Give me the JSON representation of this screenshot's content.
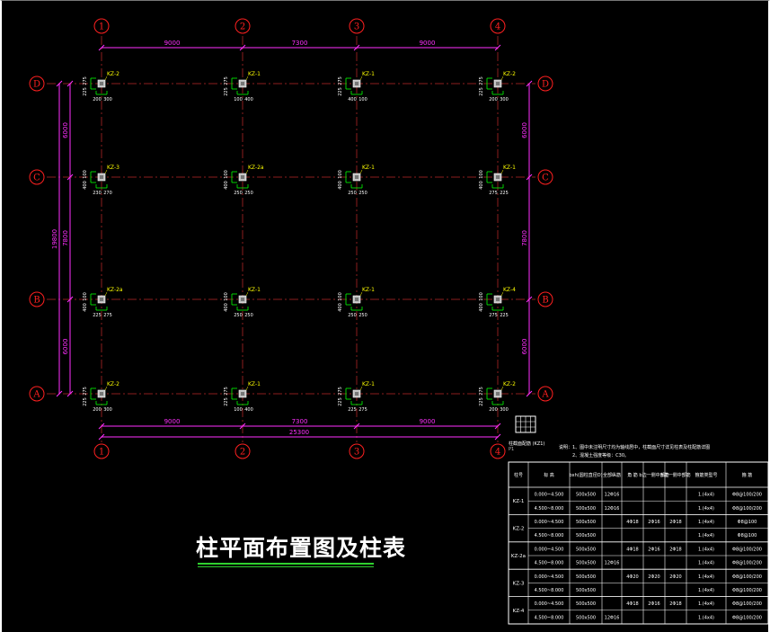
{
  "drawing": {
    "title": "柱平面布置图及柱表",
    "note_line1": "说明：1、图中未注明尺寸均为轴线居中，柱截面尺寸详见柱表及柱配筋详图",
    "note_line2": "2、混凝土强度等级：C30。",
    "section_label": "柱截面配筋  (KZ1)",
    "section_sub": "P1"
  },
  "axes": {
    "columns": [
      "1",
      "2",
      "3",
      "4"
    ],
    "rows": [
      "D",
      "C",
      "B",
      "A"
    ]
  },
  "dimensions": {
    "top_spans": [
      "9000",
      "7300",
      "9000"
    ],
    "bottom_spans": [
      "9000",
      "7300",
      "9000"
    ],
    "bottom_total": "25300",
    "left_spans": [
      "6000",
      "7800",
      "6000"
    ],
    "left_total": "19800",
    "right_spans": [
      "6000",
      "7800",
      "6000"
    ]
  },
  "columns": [
    {
      "label": "KZ-2",
      "dim_a": "275",
      "dim_b": "225",
      "bot_a": "200",
      "bot_b": "300"
    },
    {
      "label": "KZ-1",
      "dim_a": "275",
      "dim_b": "225",
      "bot_a": "100",
      "bot_b": "400"
    },
    {
      "label": "KZ-1",
      "dim_a": "275",
      "dim_b": "225",
      "bot_a": "400",
      "bot_b": "100"
    },
    {
      "label": "KZ-2",
      "dim_a": "275",
      "dim_b": "225",
      "bot_a": "200",
      "bot_b": "300"
    },
    {
      "label": "KZ-3",
      "dim_a": "100",
      "dim_b": "400",
      "bot_a": "230",
      "bot_b": "270"
    },
    {
      "label": "KZ-2a",
      "dim_a": "100",
      "dim_b": "400",
      "bot_a": "250",
      "bot_b": "250"
    },
    {
      "label": "KZ-1",
      "dim_a": "100",
      "dim_b": "400",
      "bot_a": "250",
      "bot_b": "250"
    },
    {
      "label": "KZ-1",
      "dim_a": "100",
      "dim_b": "400",
      "bot_a": "275",
      "bot_b": "225"
    },
    {
      "label": "KZ-2a",
      "dim_a": "100",
      "dim_b": "400",
      "bot_a": "225",
      "bot_b": "275"
    },
    {
      "label": "KZ-1",
      "dim_a": "100",
      "dim_b": "400",
      "bot_a": "250",
      "bot_b": "250"
    },
    {
      "label": "KZ-1",
      "dim_a": "100",
      "dim_b": "400",
      "bot_a": "250",
      "bot_b": "250"
    },
    {
      "label": "KZ-4",
      "dim_a": "100",
      "dim_b": "400",
      "bot_a": "275",
      "bot_b": "225"
    },
    {
      "label": "KZ-2",
      "dim_a": "275",
      "dim_b": "225",
      "bot_a": "200",
      "bot_b": "300"
    },
    {
      "label": "KZ-1",
      "dim_a": "275",
      "dim_b": "225",
      "bot_a": "100",
      "bot_b": "400"
    },
    {
      "label": "KZ-1",
      "dim_a": "275",
      "dim_b": "225",
      "bot_a": "225",
      "bot_b": "275"
    },
    {
      "label": "KZ-2",
      "dim_a": "275",
      "dim_b": "225",
      "bot_a": "200",
      "bot_b": "300"
    }
  ],
  "table": {
    "headers": [
      "柱号",
      "标 高",
      "bxh(圆柱直径D)",
      "全部纵筋",
      "角 筋",
      "b边一侧中部筋",
      "h边一侧中部筋",
      "箍筋类型号",
      "箍 筋"
    ],
    "groups": [
      {
        "name": "KZ-1",
        "rows": [
          [
            "0.000~4.500",
            "500x500",
            "12Φ16",
            "",
            "",
            "",
            "1.(4x4)",
            "Φ8@100/200"
          ],
          [
            "4.500~8.000",
            "500x500",
            "12Φ16",
            "",
            "",
            "",
            "1.(4x4)",
            "Φ8@100/200"
          ]
        ]
      },
      {
        "name": "KZ-2",
        "rows": [
          [
            "0.000~4.500",
            "500x500",
            "",
            "4Φ18",
            "2Φ16",
            "2Φ18",
            "1.(4x4)",
            "Φ8@100"
          ],
          [
            "4.500~8.000",
            "500x500",
            "",
            "",
            "",
            "",
            "1.(4x4)",
            "Φ8@100"
          ]
        ]
      },
      {
        "name": "KZ-2a",
        "rows": [
          [
            "0.000~4.500",
            "500x500",
            "",
            "4Φ18",
            "2Φ16",
            "2Φ18",
            "1.(4x4)",
            "Φ8@100/200"
          ],
          [
            "4.500~8.000",
            "500x500",
            "12Φ16",
            "",
            "",
            "",
            "1.(4x4)",
            "Φ8@100/200"
          ]
        ]
      },
      {
        "name": "KZ-3",
        "rows": [
          [
            "0.000~4.500",
            "500x500",
            "",
            "4Φ20",
            "2Φ20",
            "2Φ20",
            "1.(4x4)",
            "Φ8@100/200"
          ],
          [
            "4.500~8.000",
            "500x500",
            "",
            "",
            "",
            "",
            "1.(4x4)",
            "Φ8@100/200"
          ]
        ]
      },
      {
        "name": "KZ-4",
        "rows": [
          [
            "0.000~4.500",
            "500x500",
            "",
            "4Φ18",
            "2Φ16",
            "2Φ18",
            "1.(4x4)",
            "Φ8@100/200"
          ],
          [
            "4.500~8.000",
            "500x500",
            "12Φ16",
            "",
            "",
            "",
            "1.(4x4)",
            "Φ8@100/200"
          ]
        ]
      }
    ]
  },
  "colors": {
    "axis": "#ff2020",
    "gridline": "#8c1e1e",
    "dimension": "#ff30ff",
    "label": "#ffff00",
    "rebar": "#00ff00",
    "text": "#ffffff",
    "column": "#bdbdbd"
  }
}
